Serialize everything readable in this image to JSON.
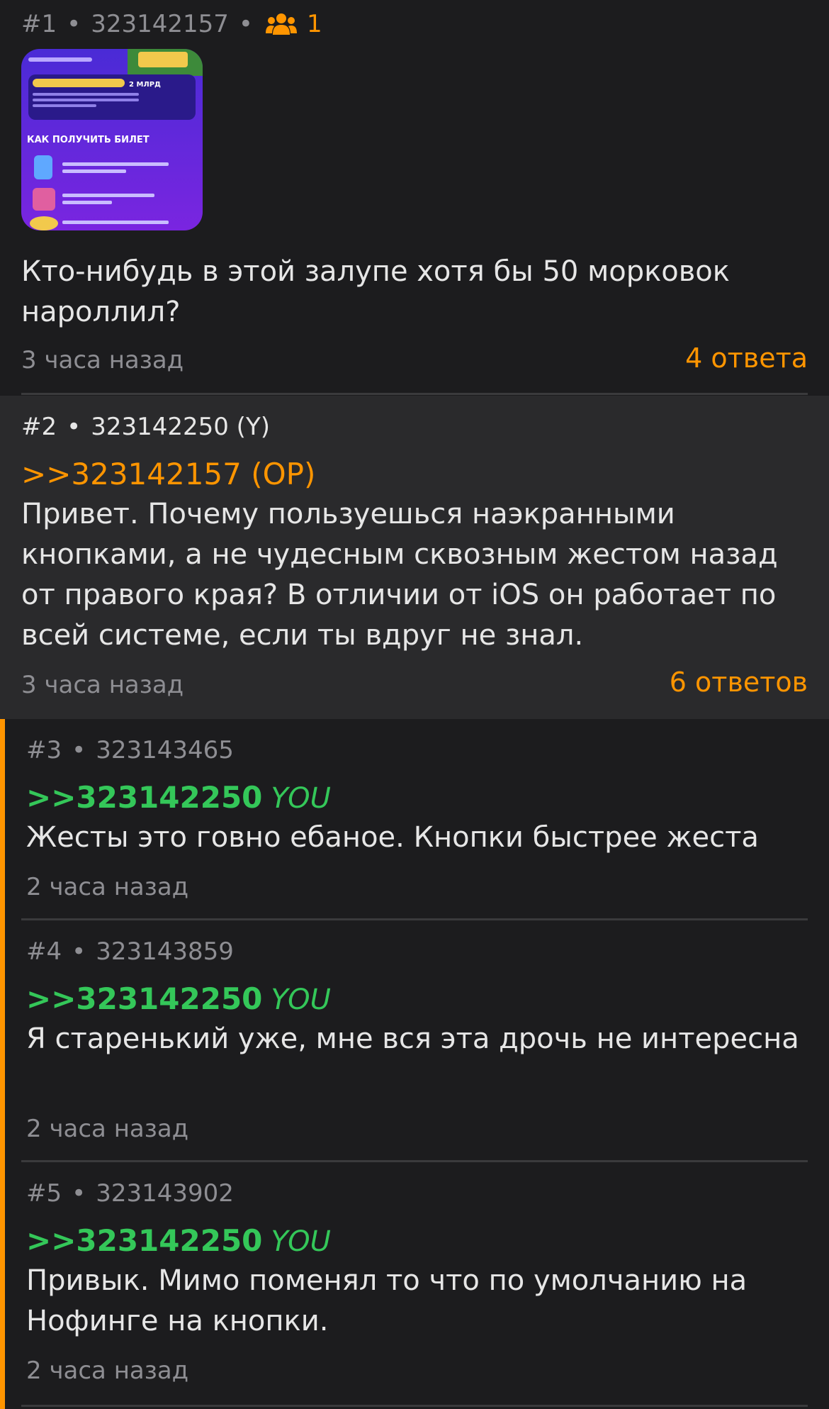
{
  "posts": [
    {
      "number": "#1",
      "id": "323142157",
      "posters_count": "1",
      "thumbnail_lines": {
        "title": "КАК ПОЛУЧИТЬ БИЛЕТ",
        "badge": "2 МЛРД"
      },
      "text": "Кто-нибудь в этой залупе хотя бы 50 морковок нароллил?",
      "time": "3 часа назад",
      "replies": "4 ответа"
    },
    {
      "number": "#2",
      "id": "323142250 (Y)",
      "reply_to": ">>323142157 (OP)",
      "text": "Привет. Почему пользуешься наэкранными кнопками, а не чудесным сквозным жестом назад от правого края? В отличии от iOS он работает по всей системе, если ты вдруг не знал.",
      "time": "3 часа назад",
      "replies": "6 ответов"
    },
    {
      "number": "#3",
      "id": "323143465",
      "reply_to": ">>323142250",
      "you": "YOU",
      "text": "Жесты это говно ебаное. Кнопки быстрее жеста",
      "time": "2 часа назад"
    },
    {
      "number": "#4",
      "id": "323143859",
      "reply_to": ">>323142250",
      "you": "YOU",
      "text": "Я старенький уже, мне вся эта дрочь не интересна",
      "time": "2 часа назад"
    },
    {
      "number": "#5",
      "id": "323143902",
      "reply_to": ">>323142250",
      "you": "YOU",
      "text": "Привык. Мимо поменял то что по умолчанию на Нофинге на кнопки.",
      "time": "2 часа назад"
    }
  ],
  "colors": {
    "accent": "#ff9500",
    "you_green": "#34c759",
    "background": "#1c1c1e",
    "highlight_background": "#2a2a2c"
  },
  "icons": {
    "posters": "people-icon"
  }
}
